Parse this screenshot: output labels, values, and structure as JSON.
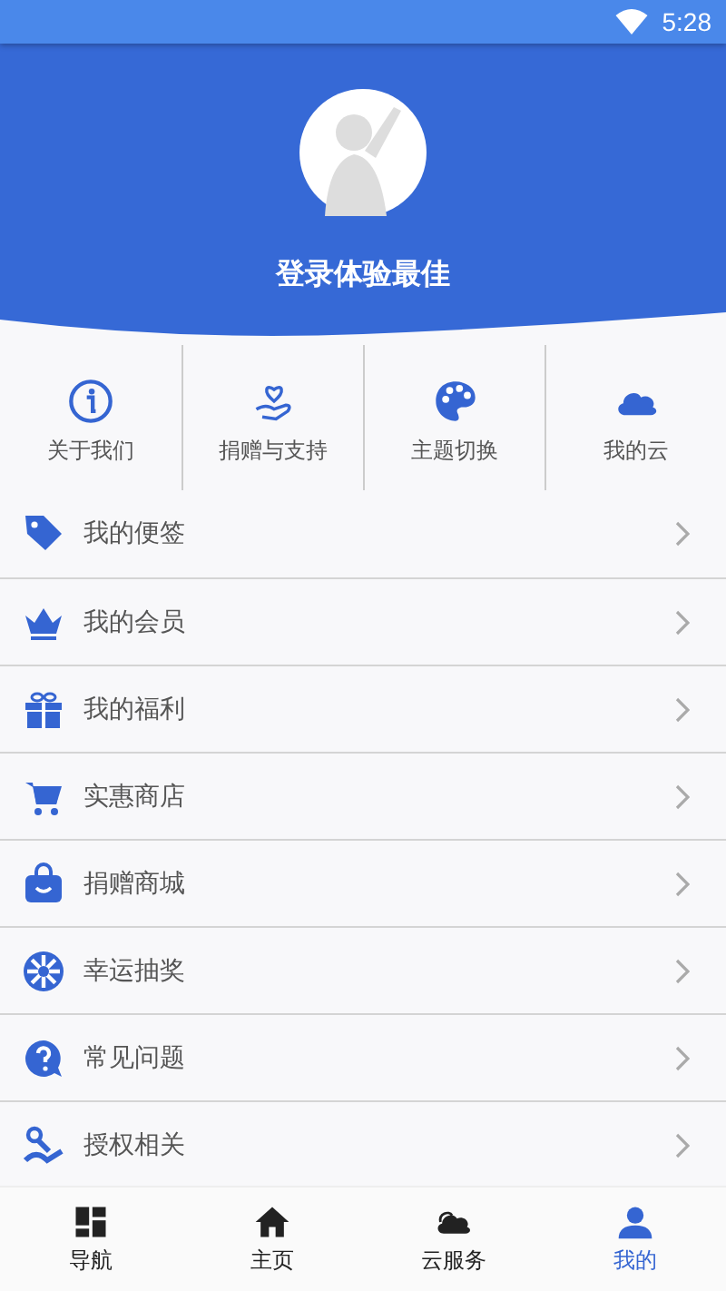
{
  "status_bar": {
    "time": "5:28"
  },
  "profile": {
    "title": "登录体验最佳"
  },
  "shortcuts": [
    {
      "kind": "info",
      "label": "关于我们"
    },
    {
      "kind": "donate",
      "label": "捐赠与支持"
    },
    {
      "kind": "palette",
      "label": "主题切换"
    },
    {
      "kind": "cloud",
      "label": "我的云"
    }
  ],
  "menu": [
    {
      "kind": "tag",
      "label": "我的便签"
    },
    {
      "kind": "crown",
      "label": "我的会员"
    },
    {
      "kind": "gift",
      "label": "我的福利"
    },
    {
      "kind": "cart",
      "label": "实惠商店"
    },
    {
      "kind": "bag",
      "label": "捐赠商城"
    },
    {
      "kind": "wheel",
      "label": "幸运抽奖"
    },
    {
      "kind": "question",
      "label": "常见问题"
    },
    {
      "kind": "key",
      "label": "授权相关"
    }
  ],
  "bottom_nav": [
    {
      "kind": "grid",
      "label": "导航",
      "selected": false
    },
    {
      "kind": "home",
      "label": "主页",
      "selected": false
    },
    {
      "kind": "cloud",
      "label": "云服务",
      "selected": false
    },
    {
      "kind": "person",
      "label": "我的",
      "selected": true
    }
  ]
}
